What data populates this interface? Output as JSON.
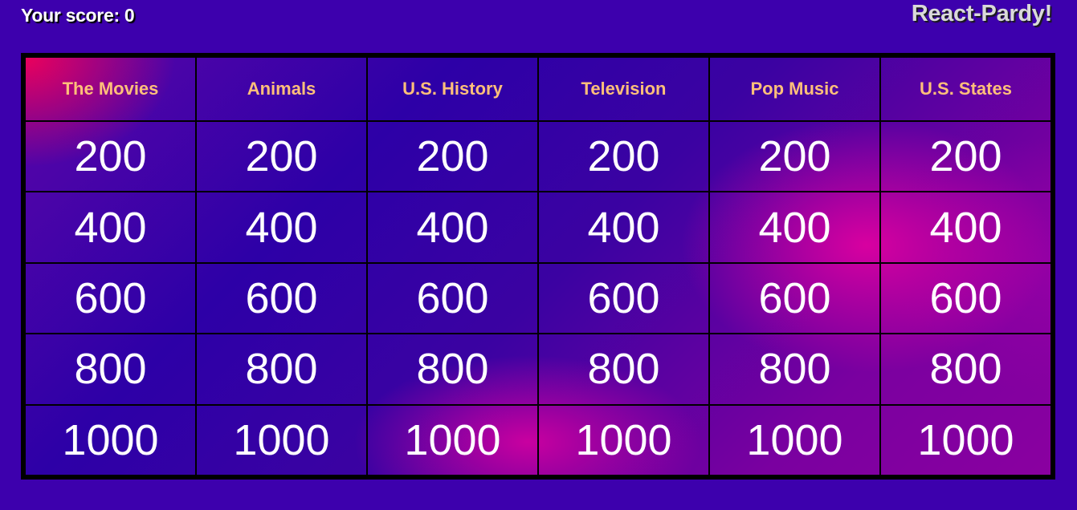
{
  "header": {
    "score_label": "Your score: 0",
    "app_title": "React-Pardy!"
  },
  "board": {
    "categories": [
      "The Movies",
      "Animals",
      "U.S. History",
      "Television",
      "Pop Music",
      "U.S. States"
    ],
    "values": [
      "200",
      "400",
      "600",
      "800",
      "1000"
    ]
  },
  "colors": {
    "background": "#3d00ad",
    "category_text": "#ffbf7a",
    "value_text": "#ffffff",
    "grid_lines": "#000000",
    "accent_pink": "#de00a0"
  }
}
